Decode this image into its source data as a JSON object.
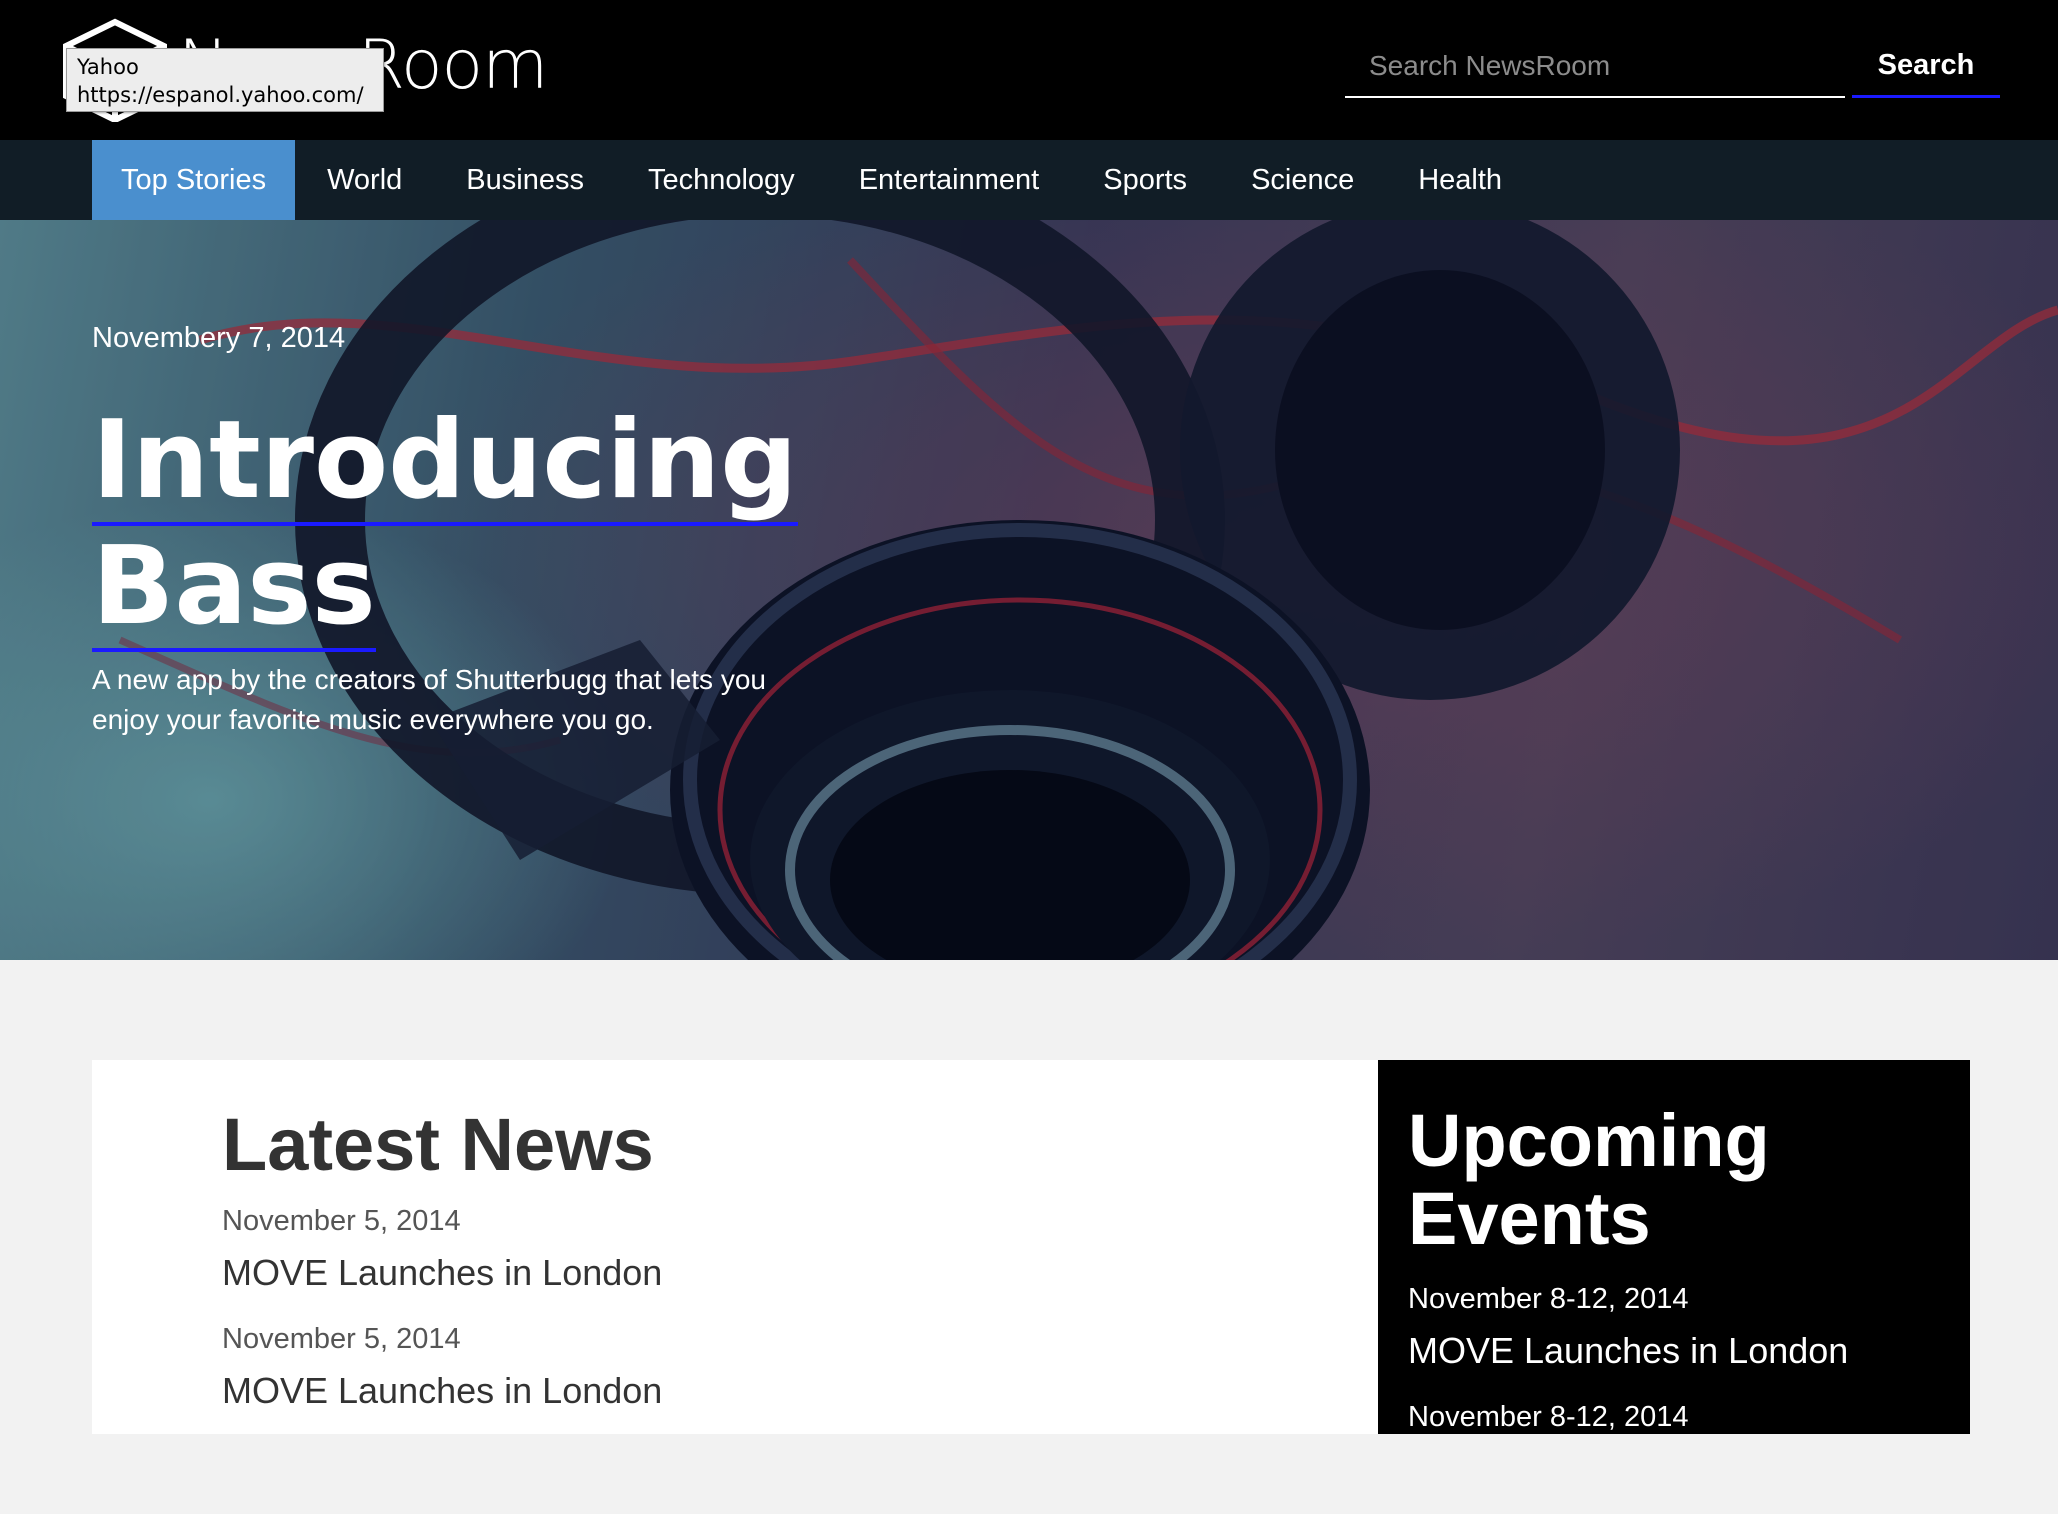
{
  "header": {
    "logo_text": "NewsRoom",
    "search_placeholder": "Search NewsRoom",
    "search_label": "Search"
  },
  "tooltip": {
    "title": "Yahoo",
    "url": "https://espanol.yahoo.com/"
  },
  "nav": {
    "items": [
      {
        "label": "Top Stories",
        "active": true
      },
      {
        "label": "World"
      },
      {
        "label": "Business"
      },
      {
        "label": "Technology"
      },
      {
        "label": "Entertainment"
      },
      {
        "label": "Sports"
      },
      {
        "label": "Science"
      },
      {
        "label": "Health"
      }
    ]
  },
  "hero": {
    "date": "Novembery 7, 2014",
    "title_line1": "Introducing",
    "title_line2": "Bass",
    "subtitle": "A new app by the creators of Shutterbugg that lets you enjoy your favorite music everywhere you go."
  },
  "latest_news": {
    "heading": "Latest News",
    "items": [
      {
        "date": "November 5, 2014",
        "title": "MOVE Launches in London"
      },
      {
        "date": "November 5, 2014",
        "title": "MOVE Launches in London"
      }
    ]
  },
  "upcoming_events": {
    "heading": "Upcoming Events",
    "items": [
      {
        "date": "November 8-12, 2014",
        "title": "MOVE Launches in London"
      },
      {
        "date": "November 8-12, 2014",
        "title": ""
      }
    ]
  },
  "colors": {
    "header_bg": "#000000",
    "nav_bg": "#111d26",
    "nav_active": "#4a8fce",
    "accent_underline": "#1a1aff",
    "page_bg": "#f2f2f2"
  }
}
